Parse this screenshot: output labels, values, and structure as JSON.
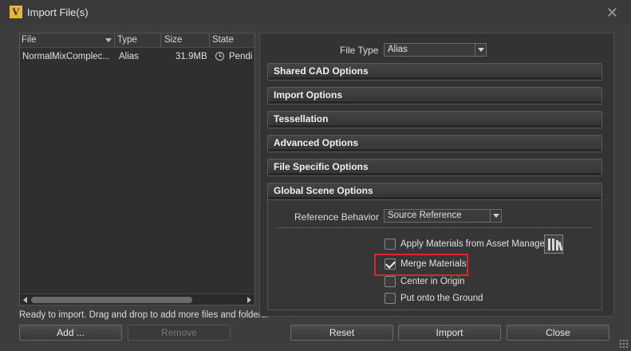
{
  "window": {
    "logo_letter": "V",
    "title": "Import File(s)",
    "close_glyph": "✕"
  },
  "file_table": {
    "headers": [
      "File",
      "Type",
      "Size",
      "State"
    ],
    "rows": [
      {
        "file": "NormalMixComplec...",
        "type": "Alias",
        "size": "31.9MB",
        "state": "Pendi"
      }
    ]
  },
  "status": "Ready to import. Drag and drop to add more files and folders.",
  "buttons": {
    "add": "Add ...",
    "remove": "Remove",
    "reset": "Reset",
    "import": "Import",
    "close": "Close"
  },
  "file_type": {
    "label": "File Type",
    "value": "Alias"
  },
  "sections": [
    "Shared CAD Options",
    "Import Options",
    "Tessellation",
    "Advanced Options",
    "File Specific Options",
    "Global Scene Options"
  ],
  "global_scene": {
    "reference_label": "Reference Behavior",
    "reference_value": "Source Reference",
    "options": [
      {
        "label": "Apply Materials from Asset Manager",
        "checked": false
      },
      {
        "label": "Merge Materials",
        "checked": true
      },
      {
        "label": "Center in Origin",
        "checked": false
      },
      {
        "label": "Put onto the Ground",
        "checked": false
      }
    ]
  },
  "colors": {
    "highlight": "#e0242b",
    "logo": "#e8b43a"
  }
}
